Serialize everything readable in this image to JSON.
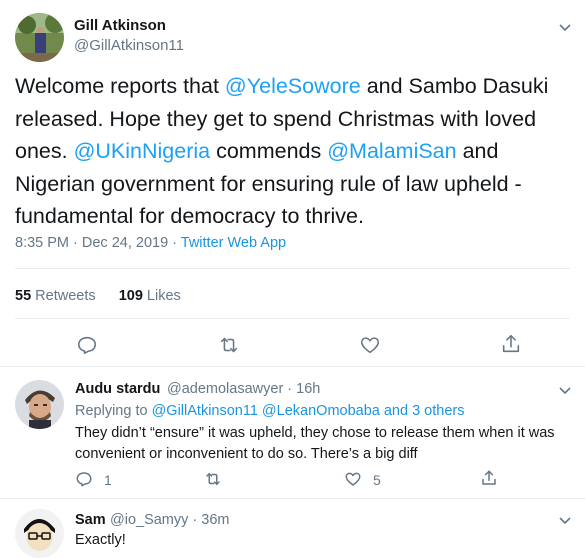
{
  "tweet": {
    "author_name": "Gill Atkinson",
    "author_handle": "@GillAtkinson11",
    "text": [
      {
        "t": "Welcome reports that ",
        "link": false
      },
      {
        "t": "@YeleSowore",
        "link": true
      },
      {
        "t": " and Sambo Dasuki released. Hope they get to spend Christmas with loved ones. ",
        "link": false
      },
      {
        "t": "@UKinNigeria",
        "link": true
      },
      {
        "t": " commends ",
        "link": false
      },
      {
        "t": "@MalamiSan",
        "link": true
      },
      {
        "t": " and Nigerian government for ensuring rule of law upheld - fundamental for democracy to thrive.",
        "link": false
      }
    ],
    "timestamp": "8:35 PM · Dec 24, 2019",
    "separator": " · ",
    "source": "Twitter Web App",
    "retweets_count": "55",
    "retweets_label": "Retweets",
    "likes_count": "109",
    "likes_label": "Likes"
  },
  "replies": [
    {
      "name": "Audu stardu",
      "handle_time": "@ademolasawyer · 16h",
      "context_prefix": "Replying to ",
      "context_links": "@GillAtkinson11 @LekanOmobaba and 3 others",
      "text": "They didn’t “ensure” it was upheld, they chose to release them when it was convenient or inconvenient to do so. There’s a big diff",
      "reply_count": "1",
      "like_count": "5"
    },
    {
      "name": "Sam",
      "handle_time": "@io_Samyy · 36m",
      "text": "Exactly!"
    }
  ],
  "colors": {
    "link": "#1da1f2",
    "secondary_text": "#657786",
    "divider": "#e6ecf0"
  },
  "icons": [
    "chevron-down-icon",
    "reply-icon",
    "retweet-icon",
    "like-icon",
    "share-icon"
  ]
}
